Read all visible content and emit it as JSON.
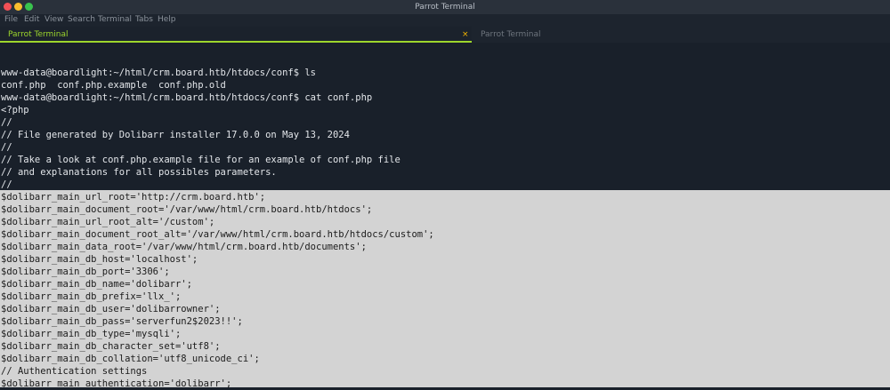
{
  "window": {
    "title": "Parrot Terminal"
  },
  "menu": {
    "items": [
      "File",
      "Edit",
      "View",
      "Search",
      "Terminal",
      "Tabs",
      "Help"
    ]
  },
  "tabs": [
    {
      "label": "Parrot Terminal",
      "active": true,
      "close_glyph": "×"
    },
    {
      "label": "Parrot Terminal",
      "active": false
    }
  ],
  "terminal": {
    "lines": [
      "www-data@boardlight:~/html/crm.board.htb/htdocs/conf$ ls",
      "conf.php  conf.php.example  conf.php.old",
      "www-data@boardlight:~/html/crm.board.htb/htdocs/conf$ cat conf.php",
      "<?php",
      "//",
      "// File generated by Dolibarr installer 17.0.0 on May 13, 2024",
      "//",
      "// Take a look at conf.php.example file for an example of conf.php file",
      "// and explanations for all possibles parameters.",
      "//"
    ],
    "highlighted_lines": [
      "$dolibarr_main_url_root='http://crm.board.htb';",
      "$dolibarr_main_document_root='/var/www/html/crm.board.htb/htdocs';",
      "$dolibarr_main_url_root_alt='/custom';",
      "$dolibarr_main_document_root_alt='/var/www/html/crm.board.htb/htdocs/custom';",
      "$dolibarr_main_data_root='/var/www/html/crm.board.htb/documents';",
      "$dolibarr_main_db_host='localhost';",
      "$dolibarr_main_db_port='3306';",
      "$dolibarr_main_db_name='dolibarr';",
      "$dolibarr_main_db_prefix='llx_';",
      "$dolibarr_main_db_user='dolibarrowner';",
      "$dolibarr_main_db_pass='serverfun2$2023!!';",
      "$dolibarr_main_db_type='mysqli';",
      "$dolibarr_main_db_character_set='utf8';",
      "$dolibarr_main_db_collation='utf8_unicode_ci';",
      "// Authentication settings",
      "$dolibarr_main_authentication='dolibarr';"
    ]
  },
  "colors": {
    "terminal_bg": "#19202a",
    "active_tab_accent": "#9dd62c",
    "selection_bg": "#d3d3d3",
    "close_button": "#f25056",
    "minimize_button": "#f9be2e",
    "maximize_button": "#39c34e"
  },
  "icons": [
    "close-window-icon",
    "minimize-window-icon",
    "maximize-window-icon",
    "tab-close-icon"
  ]
}
